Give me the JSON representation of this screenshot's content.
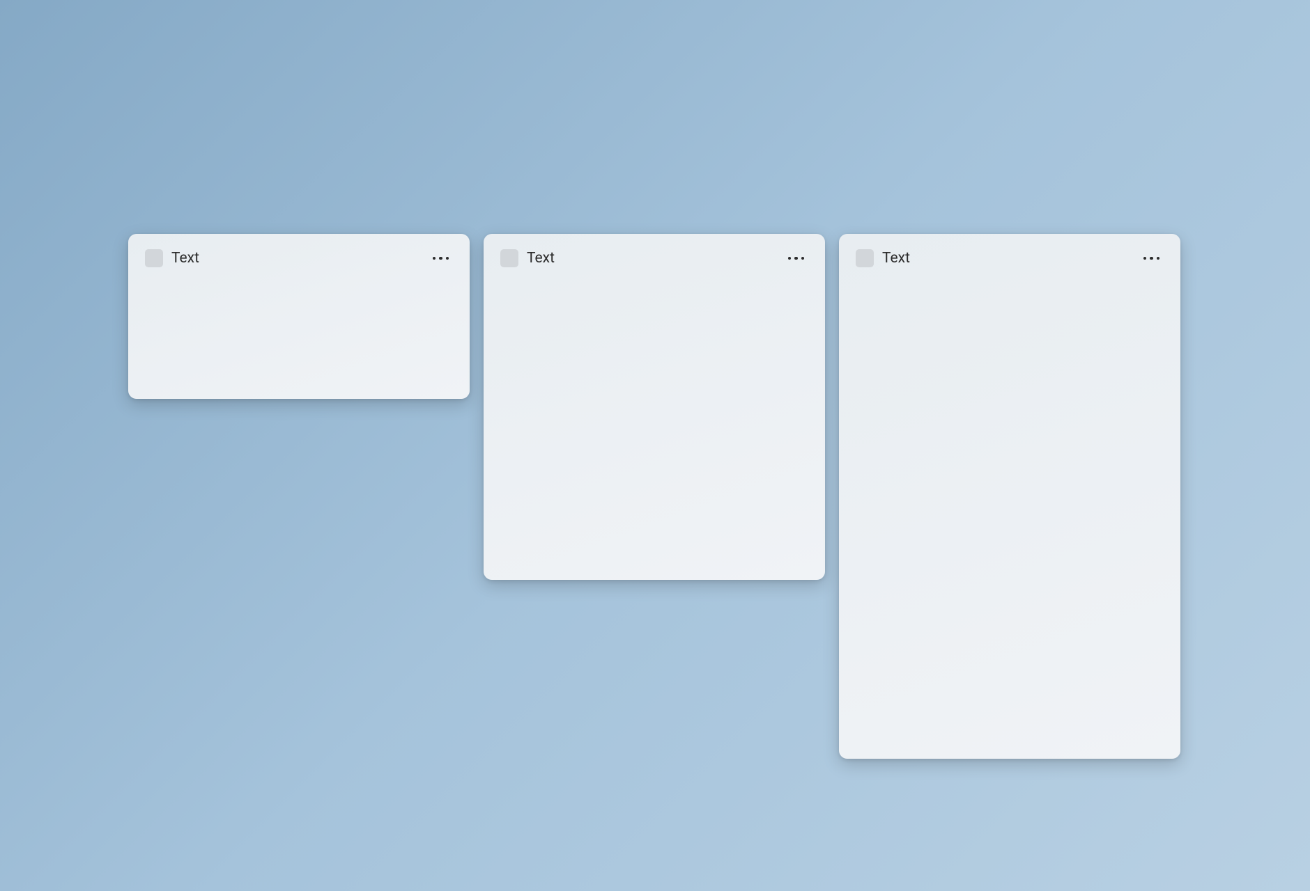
{
  "cards": [
    {
      "title": "Text",
      "icon": "placeholder-icon"
    },
    {
      "title": "Text",
      "icon": "placeholder-icon"
    },
    {
      "title": "Text",
      "icon": "placeholder-icon"
    }
  ]
}
